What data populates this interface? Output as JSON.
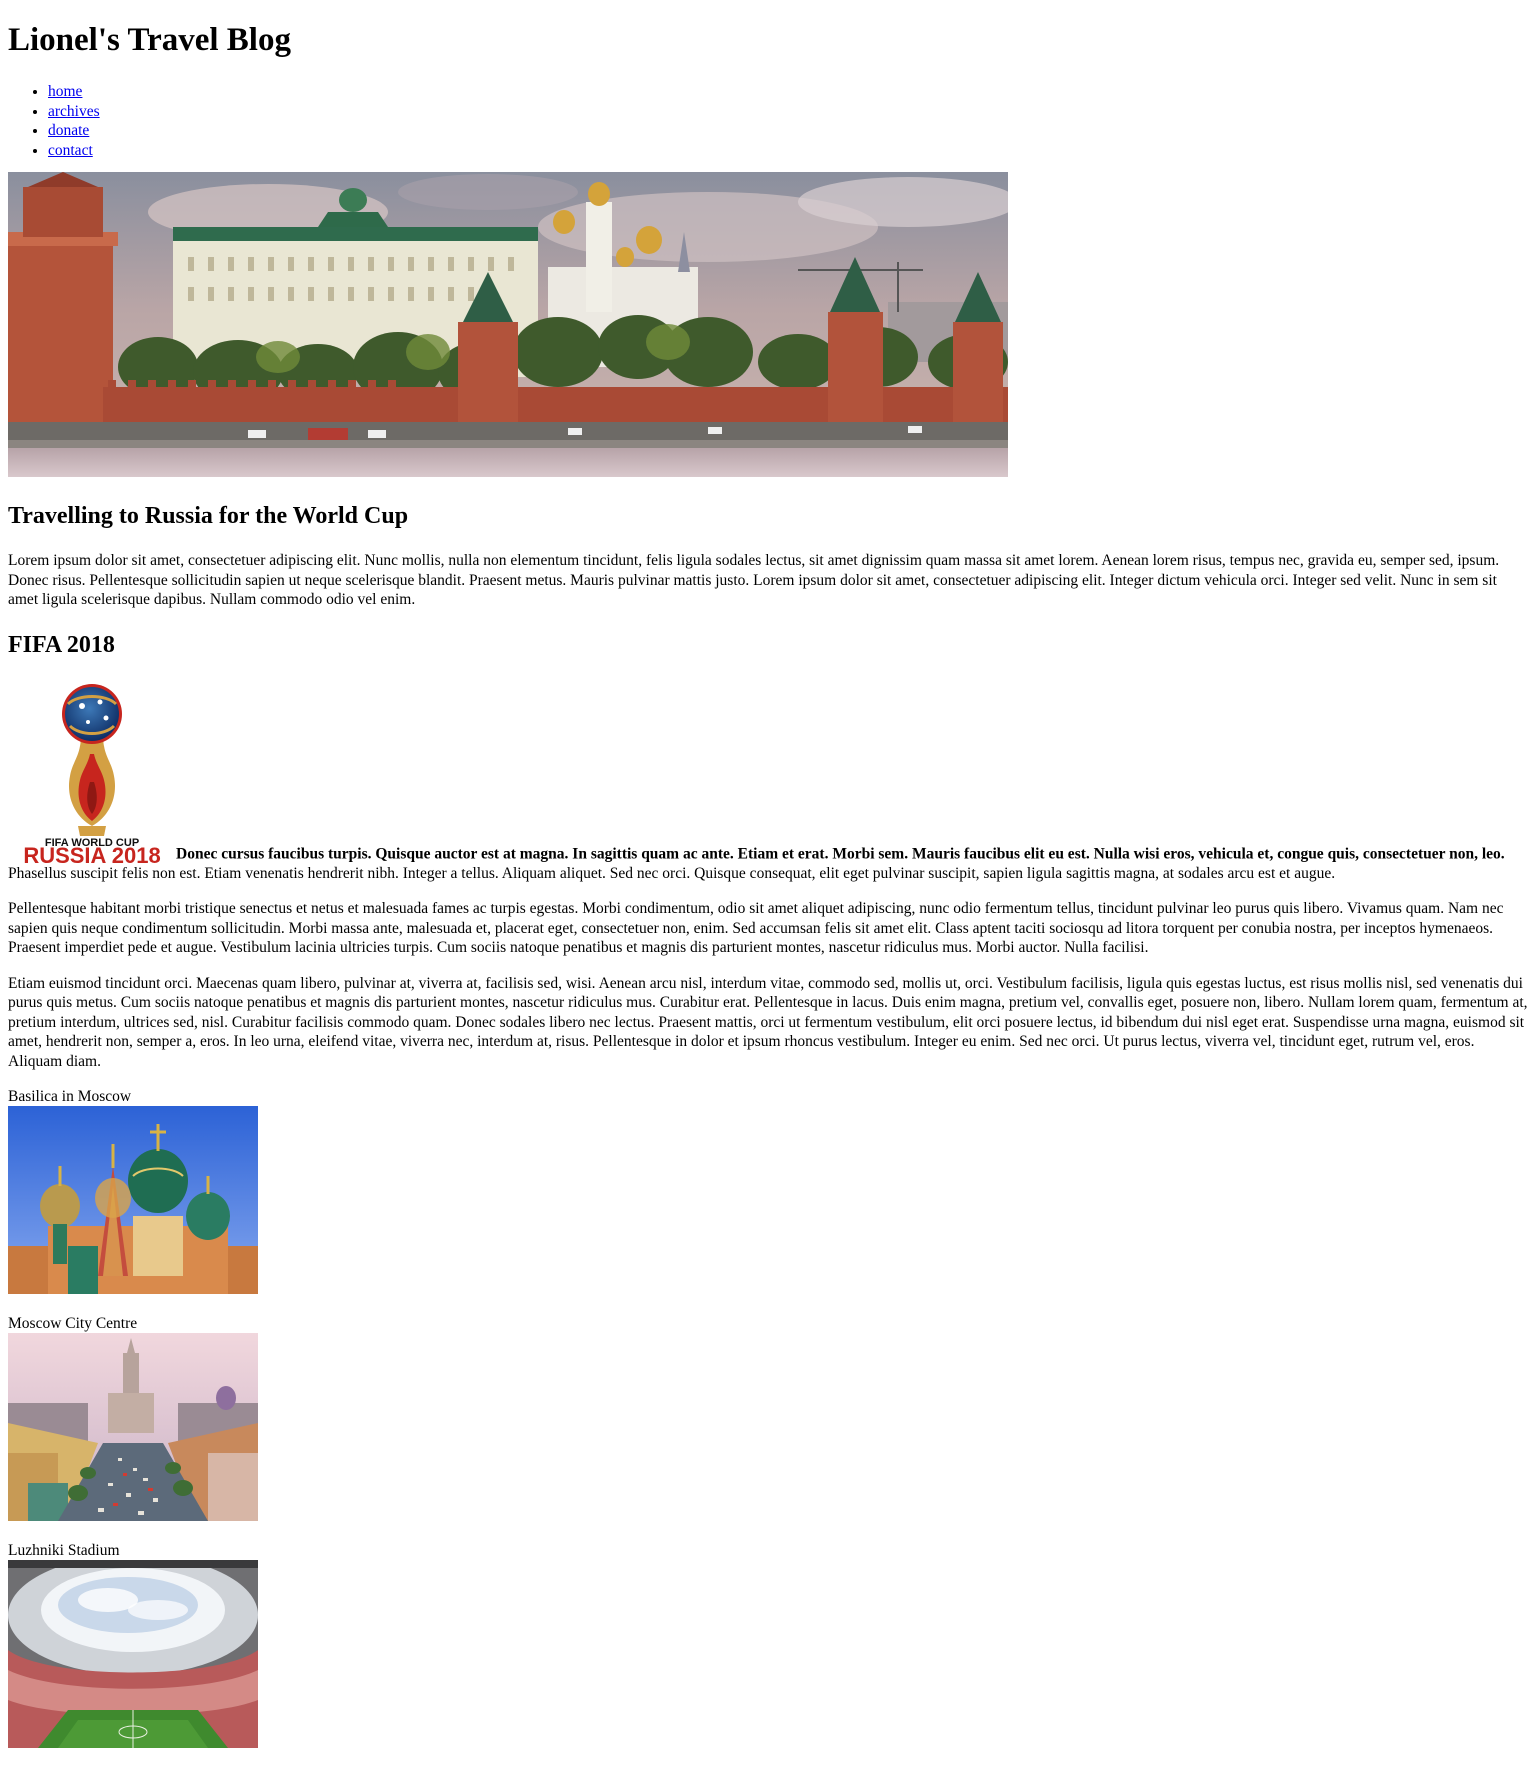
{
  "site": {
    "title": "Lionel's Travel Blog"
  },
  "nav": {
    "items": [
      {
        "label": "home"
      },
      {
        "label": "archives"
      },
      {
        "label": "donate"
      },
      {
        "label": "contact"
      }
    ]
  },
  "hero": {
    "alt": "Moscow Kremlin panorama",
    "icon": "kremlin-photo"
  },
  "post": {
    "title": "Travelling to Russia for the World Cup",
    "intro": "Lorem ipsum dolor sit amet, consectetuer adipiscing elit. Nunc mollis, nulla non elementum tincidunt, felis ligula sodales lectus, sit amet dignissim quam massa sit amet lorem. Aenean lorem risus, tempus nec, gravida eu, semper sed, ipsum. Donec risus. Pellentesque sollicitudin sapien ut neque scelerisque blandit. Praesent metus. Mauris pulvinar mattis justo. Lorem ipsum dolor sit amet, consectetuer adipiscing elit. Integer dictum vehicula orci. Integer sed velit. Nunc in sem sit amet ligula scelerisque dapibus. Nullam commodo odio vel enim."
  },
  "fifa": {
    "title": "FIFA 2018",
    "logo": {
      "line1": "FIFA WORLD CUP",
      "line2": "RUSSIA 2018"
    },
    "lead_bold": "Donec cursus faucibus turpis. Quisque auctor est at magna. In sagittis quam ac ante. Etiam et erat. Morbi sem. Mauris faucibus elit eu est. Nulla wisi eros, vehicula et, congue quis, consectetuer non, leo.",
    "lead_rest": " Phasellus suscipit felis non est. Etiam venenatis hendrerit nibh. Integer a tellus. Aliquam aliquet. Sed nec orci. Quisque consequat, elit eget pulvinar suscipit, sapien ligula sagittis magna, at sodales arcu est et augue.",
    "para2": "Pellentesque habitant morbi tristique senectus et netus et malesuada fames ac turpis egestas. Morbi condimentum, odio sit amet aliquet adipiscing, nunc odio fermentum tellus, tincidunt pulvinar leo purus quis libero. Vivamus quam. Nam nec sapien quis neque condimentum sollicitudin. Morbi massa ante, malesuada et, placerat eget, consectetuer non, enim. Sed accumsan felis sit amet elit. Class aptent taciti sociosqu ad litora torquent per conubia nostra, per inceptos hymenaeos. Praesent imperdiet pede et augue. Vestibulum lacinia ultricies turpis. Cum sociis natoque penatibus et magnis dis parturient montes, nascetur ridiculus mus. Morbi auctor. Nulla facilisi.",
    "para3": "Etiam euismod tincidunt orci. Maecenas quam libero, pulvinar at, viverra at, facilisis sed, wisi. Aenean arcu nisl, interdum vitae, commodo sed, mollis ut, orci. Vestibulum facilisis, ligula quis egestas luctus, est risus mollis nisl, sed venenatis dui purus quis metus. Cum sociis natoque penatibus et magnis dis parturient montes, nascetur ridiculus mus. Curabitur erat. Pellentesque in lacus. Duis enim magna, pretium vel, convallis eget, posuere non, libero. Nullam lorem quam, fermentum at, pretium interdum, ultrices sed, nisl. Curabitur facilisis commodo quam. Donec sodales libero nec lectus. Praesent mattis, orci ut fermentum vestibulum, elit orci posuere lectus, id bibendum dui nisl eget erat. Suspendisse urna magna, euismod sit amet, hendrerit non, semper a, eros. In leo urna, eleifend vitae, viverra nec, interdum at, risus. Pellentesque in dolor et ipsum rhoncus vestibulum. Integer eu enim. Sed nec orci. Ut purus lectus, viverra vel, tincidunt eget, rutrum vel, eros. Aliquam diam."
  },
  "gallery": [
    {
      "caption": "Basilica in Moscow",
      "icon": "basilica-photo"
    },
    {
      "caption": "Moscow City Centre",
      "icon": "city-centre-photo"
    },
    {
      "caption": "Luzhniki Stadium",
      "icon": "stadium-photo"
    }
  ]
}
